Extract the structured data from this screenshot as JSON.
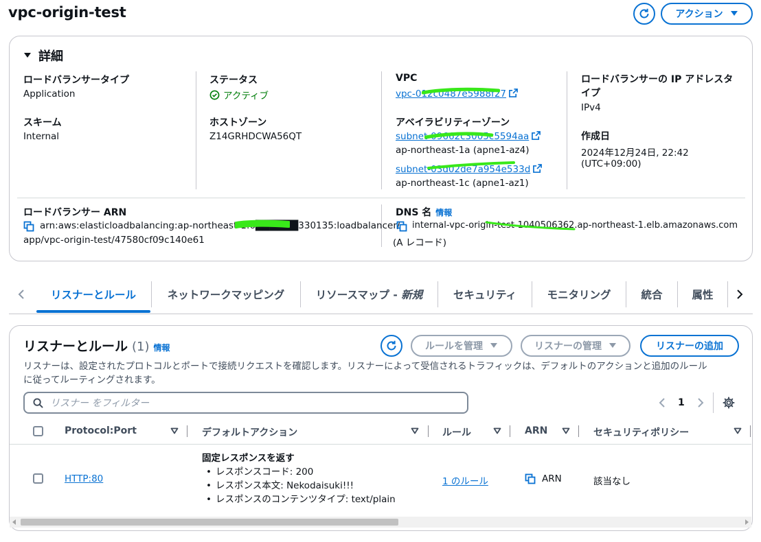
{
  "header": {
    "title": "vpc-origin-test",
    "actions_label": "アクション"
  },
  "details": {
    "section_title": "詳細",
    "lb_type_label": "ロードバランサータイプ",
    "lb_type_value": "Application",
    "scheme_label": "スキーム",
    "scheme_value": "Internal",
    "status_label": "ステータス",
    "status_value": "アクティブ",
    "hosted_zone_label": "ホストゾーン",
    "hosted_zone_value": "Z14GRHDCWA56QT",
    "vpc_label": "VPC",
    "vpc_value": "vpc-012c0487e5988f27",
    "az_label": "アベイラビリティーゾーン",
    "subnets": [
      {
        "id": "subnet-09662c3005c5594aa",
        "az": "ap-northeast-1a (apne1-az4)"
      },
      {
        "id": "subnet-03d02de7a954e533d",
        "az": "ap-northeast-1c (apne1-az1)"
      }
    ],
    "ip_type_label": "ロードバランサーの IP アドレスタイプ",
    "ip_type_value": "IPv4",
    "created_label": "作成日",
    "created_value": "2024年12月24日, 22:42",
    "created_tz": "(UTC+09:00)",
    "arn_label": "ロードバランサー ARN",
    "arn_line1": "arn:aws:elasticloadbalancing:ap-northeast-1:6██████330135:loadbalancer/",
    "arn_line2": "app/vpc-origin-test/47580cf09c140e61",
    "dns_label": "DNS 名",
    "dns_info": "情報",
    "dns_value": "internal-vpc-origin-test-1040506362.ap-northeast-1.elb.amazonaws.com",
    "dns_record": "(A レコード)"
  },
  "tabs": [
    {
      "label": "リスナーとルール",
      "active": true
    },
    {
      "label": "ネットワークマッピング"
    },
    {
      "label": "リソースマップ - ",
      "badge": "新規"
    },
    {
      "label": "セキュリティ"
    },
    {
      "label": "モニタリング"
    },
    {
      "label": "統合"
    },
    {
      "label": "属性"
    }
  ],
  "listeners": {
    "title": "リスナーとルール",
    "count": "(1)",
    "info": "情報",
    "manage_rules": "ルールを管理",
    "manage_listeners": "リスナーの管理",
    "add_listener": "リスナーの追加",
    "description": "リスナーは、設定されたプロトコルとポートで接続リクエストを確認します。リスナーによって受信されるトラフィックは、デフォルトのアクションと追加のルール",
    "description2": "に従ってルーティングされます。",
    "filter_placeholder": "リスナー をフィルター",
    "page": "1",
    "columns": [
      "Protocol:Port",
      "デフォルトアクション",
      "ルール",
      "ARN",
      "セキュリティポリシー"
    ],
    "rows": [
      {
        "protocol_port": "HTTP:80",
        "action_title": "固定レスポンスを返す",
        "action_items": [
          "レスポンスコード: 200",
          "レスポンス本文: Nekodaisuki!!!",
          "レスポンスのコンテンツタイプ: text/plain"
        ],
        "rules": "1 のルール",
        "arn": "ARN",
        "security_policy": "該当なし"
      }
    ]
  },
  "colors": {
    "link": "#0972d3",
    "success": "#037f0c",
    "border": "#c6c6cd",
    "redaction": "#39e81a"
  }
}
